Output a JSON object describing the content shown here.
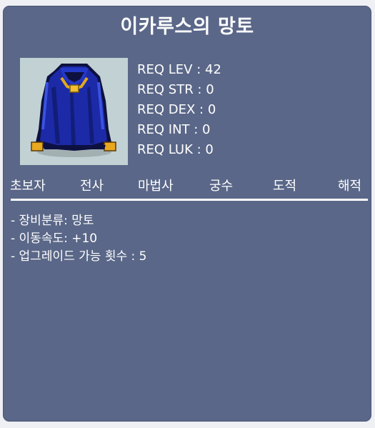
{
  "item": {
    "name": "이카루스의 망토",
    "icon": "blue-cape-icon"
  },
  "requirements": [
    {
      "text": "REQ LEV : 42"
    },
    {
      "text": "REQ STR : 0"
    },
    {
      "text": "REQ DEX : 0"
    },
    {
      "text": "REQ INT : 0"
    },
    {
      "text": "REQ LUK : 0"
    }
  ],
  "jobs": [
    {
      "label": "초보자"
    },
    {
      "label": "전사"
    },
    {
      "label": "마법사"
    },
    {
      "label": "궁수"
    },
    {
      "label": "도적"
    },
    {
      "label": "해적"
    }
  ],
  "stats": [
    {
      "text": "- 장비분류: 망토"
    },
    {
      "text": "- 이동속도: +10"
    },
    {
      "text": "- 업그레이드 가능 횟수 : 5"
    }
  ],
  "colors": {
    "panel": "#5a6788",
    "icon_bg": "#c2d1d3",
    "text": "#ffffff"
  }
}
